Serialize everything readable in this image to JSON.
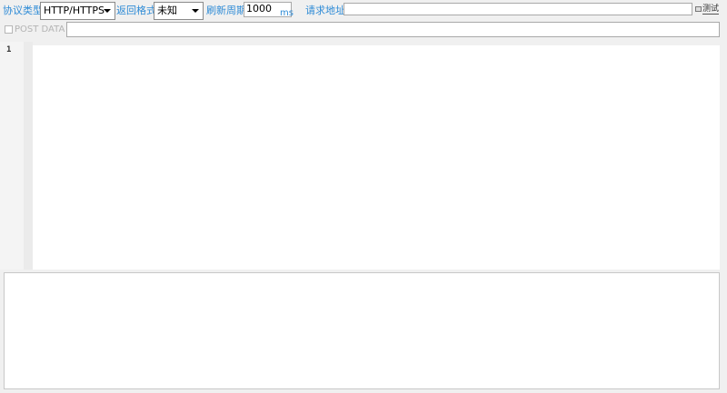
{
  "toolbar": {
    "protocol_label": "协议类型:",
    "protocol_value": "HTTP/HTTPS",
    "format_label": "返回格式:",
    "format_value": "未知",
    "refresh_label": "刷新周期:",
    "refresh_value": "1000",
    "refresh_unit": "ms",
    "url_label": "请求地址:",
    "url_value": "",
    "test_button": "测试"
  },
  "post": {
    "checkbox_label": "POST DATA",
    "checked": false,
    "value": ""
  },
  "editor": {
    "line_numbers": [
      "1"
    ],
    "content": ""
  },
  "output": {
    "content": ""
  }
}
